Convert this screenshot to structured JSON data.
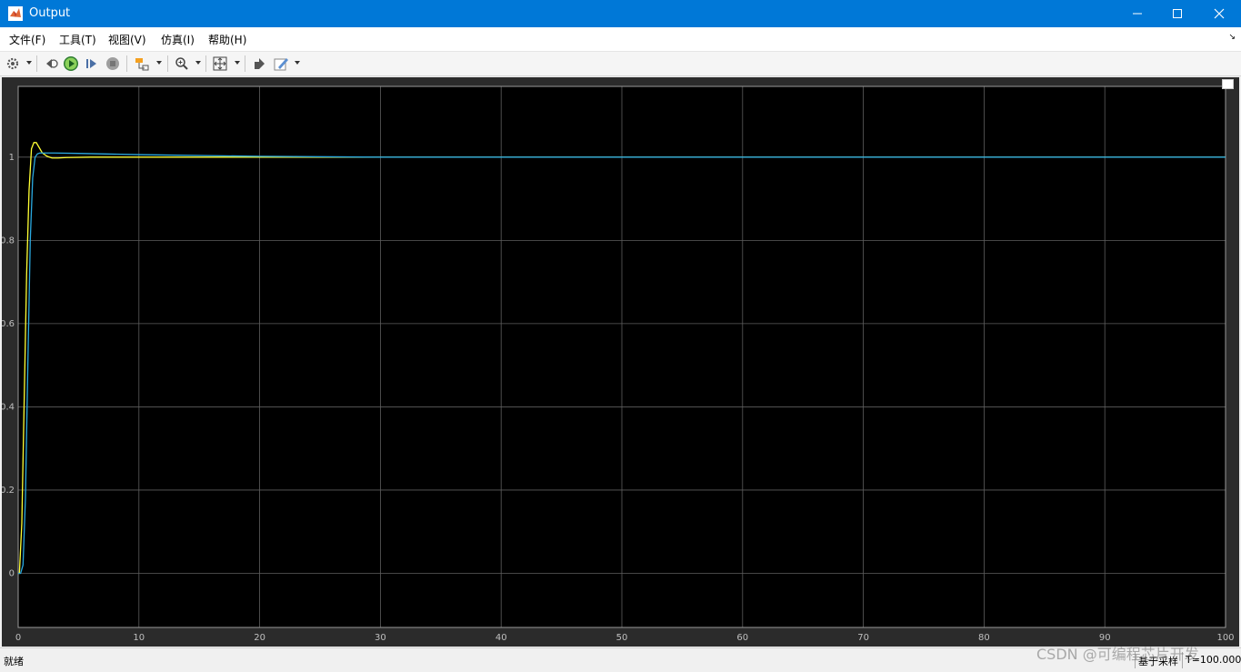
{
  "window": {
    "title": "Output"
  },
  "menu": [
    {
      "label": "文件(F)"
    },
    {
      "label": "工具(T)"
    },
    {
      "label": "视图(V)"
    },
    {
      "label": "仿真(I)"
    },
    {
      "label": "帮助(H)"
    }
  ],
  "toolbar": {
    "icons": [
      "gear-icon",
      "step-back-icon",
      "run-icon",
      "step-forward-icon",
      "stop-icon",
      "signal-select-icon",
      "zoom-icon",
      "fit-axes-icon",
      "highlight-simulink-icon",
      "style-icon"
    ]
  },
  "chart_data": {
    "type": "line",
    "background": "#000000",
    "grid": true,
    "xlim": [
      0,
      100
    ],
    "ylim": [
      -0.13,
      1.17
    ],
    "xticks": [
      0,
      10,
      20,
      30,
      40,
      50,
      60,
      70,
      80,
      90,
      100
    ],
    "yticks": [
      0,
      0.2,
      0.4,
      0.6,
      0.8,
      1
    ],
    "ytick_labels": [
      "0",
      "0.2",
      "0.4",
      "0.6",
      "0.8",
      "1"
    ],
    "series": [
      {
        "color": "#ffff33",
        "x": [
          0,
          0.1,
          0.3,
          0.5,
          0.7,
          0.9,
          1.1,
          1.3,
          1.5,
          1.7,
          2.0,
          2.4,
          2.8,
          3.3,
          4,
          6,
          10,
          20,
          30,
          100
        ],
        "y": [
          0,
          0.0,
          0.12,
          0.42,
          0.72,
          0.92,
          1.02,
          1.035,
          1.035,
          1.025,
          1.01,
          1.002,
          0.998,
          0.998,
          0.999,
          1.0,
          1.0,
          1.0,
          1.0,
          1.0
        ]
      },
      {
        "color": "#2aa9e0",
        "x": [
          0,
          0.2,
          0.4,
          0.6,
          0.8,
          1.0,
          1.2,
          1.4,
          1.6,
          1.8,
          2.0,
          2.5,
          3,
          5,
          10,
          20,
          30,
          100
        ],
        "y": [
          0,
          0.0,
          0.02,
          0.18,
          0.5,
          0.8,
          0.95,
          1.0,
          1.008,
          1.01,
          1.01,
          1.01,
          1.01,
          1.009,
          1.006,
          1.002,
          1.0,
          1.0
        ]
      }
    ]
  },
  "status": {
    "left": "就绪",
    "middle": "基于采样",
    "right": "T=100.000"
  },
  "watermark": "CSDN @可编程芯片开发"
}
